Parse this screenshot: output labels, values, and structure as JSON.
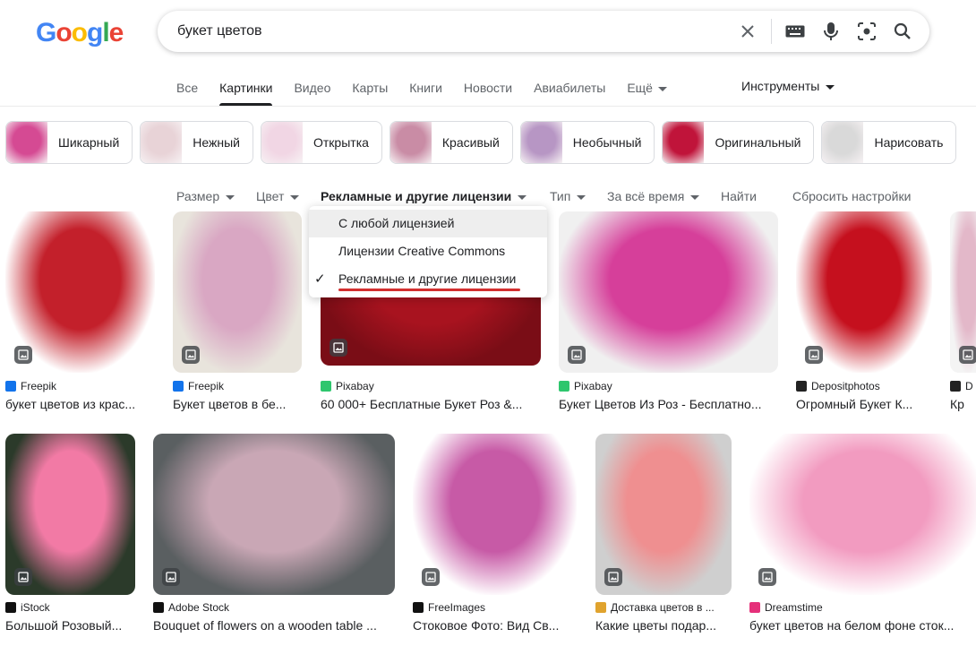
{
  "logo": {
    "letters": [
      "G",
      "o",
      "o",
      "g",
      "l",
      "e"
    ],
    "colors": [
      "#4285f4",
      "#ea4335",
      "#fbbc05",
      "#4285f4",
      "#34a853",
      "#ea4335"
    ]
  },
  "search": {
    "query": "букет цветов"
  },
  "icons": {
    "clear": "close-icon",
    "keyboard": "keyboard-icon",
    "voice": "mic-icon",
    "lens": "lens-icon",
    "search": "search-icon"
  },
  "tabs": [
    "Все",
    "Картинки",
    "Видео",
    "Карты",
    "Книги",
    "Новости",
    "Авиабилеты",
    "Ещё"
  ],
  "tools_label": "Инструменты",
  "chips": [
    {
      "label": "Шикарный",
      "color": "#d54a93"
    },
    {
      "label": "Нежный",
      "color": "#e8d3d7"
    },
    {
      "label": "Открытка",
      "color": "#f1d6e4"
    },
    {
      "label": "Красивый",
      "color": "#c98ca5"
    },
    {
      "label": "Необычный",
      "color": "#b796c4"
    },
    {
      "label": "Оригинальный",
      "color": "#c0143a"
    },
    {
      "label": "Нарисовать",
      "color": "#d9d9d9"
    }
  ],
  "filters": {
    "size": "Размер",
    "color": "Цвет",
    "license": "Рекламные и другие лицензии",
    "type": "Тип",
    "time": "За всё время",
    "find": "Найти",
    "reset": "Сбросить настройки"
  },
  "license_dropdown": {
    "options": [
      "С любой лицензией",
      "Лицензии Creative Commons",
      "Рекламные и другие лицензии"
    ],
    "hovered": 0,
    "selected": 2,
    "check": "✓"
  },
  "results": [
    {
      "source": "Freepik",
      "title": "букет цветов из крас...",
      "src_color": "#1273eb",
      "img_color": "#c3202b",
      "bg": "#ffffff"
    },
    {
      "source": "Freepik",
      "title": "Букет цветов в бе...",
      "src_color": "#1273eb",
      "img_color": "#d9a7c3",
      "bg": "#e8e4dc"
    },
    {
      "source": "Pixabay",
      "title": "60 000+ Бесплатные Букет Роз &...",
      "src_color": "#2ec66d",
      "img_color": "#a8131f",
      "bg": "#7a0d16"
    },
    {
      "source": "Pixabay",
      "title": "Букет Цветов Из Роз - Бесплатно...",
      "src_color": "#2ec66d",
      "img_color": "#d63f9a",
      "bg": "#f0f0f0"
    },
    {
      "source": "Depositphotos",
      "title": "Огромный Букет К...",
      "src_color": "#222222",
      "img_color": "#c5101e",
      "bg": "#ffffff"
    },
    {
      "source": "D",
      "title": "Кр",
      "src_color": "#222222",
      "img_color": "#e3b8c9",
      "bg": "#f4f4f4"
    },
    {
      "source": "iStock",
      "title": "Большой Розовый...",
      "src_color": "#111111",
      "img_color": "#f27aa5",
      "bg": "#2b3a2a"
    },
    {
      "source": "Adobe Stock",
      "title": "Bouquet of flowers on a wooden table ...",
      "src_color": "#111111",
      "img_color": "#c9a7b5",
      "bg": "#5a5f61"
    },
    {
      "source": "FreeImages",
      "title": "Стоковое Фото: Вид Св...",
      "src_color": "#111111",
      "img_color": "#c75aa6",
      "bg": "#ffffff"
    },
    {
      "source": "Доставка цветов в ...",
      "title": "Какие цветы подар...",
      "src_color": "#e0a32e",
      "img_color": "#ef8f90",
      "bg": "#cfcfcf"
    },
    {
      "source": "Dreamstime",
      "title": "букет цветов на белом фоне сток...",
      "src_color": "#e5307a",
      "img_color": "#f29bc0",
      "bg": "#ffffff"
    }
  ]
}
